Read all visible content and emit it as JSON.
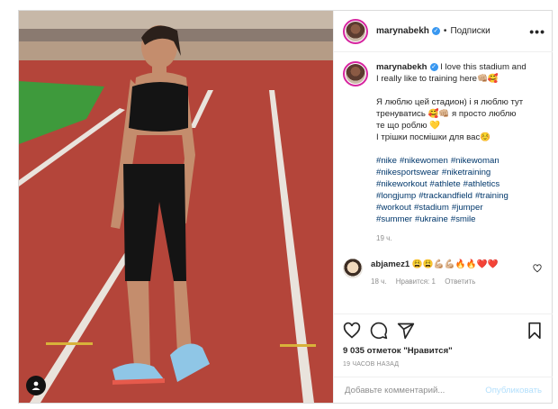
{
  "post": {
    "username": "marynabekh",
    "verified": true,
    "follow_separator": "•",
    "follow_label": "Подписки",
    "more_label": "•••",
    "caption_lines": [
      "I love this stadium and",
      "I really like to training here👊🏼🥰"
    ],
    "caption_ua": [
      "Я люблю цей стадион) і я люблю тут",
      "тренуватись 🥰👊🏼 я просто люблю",
      "те що роблю 💛",
      "І трішки посмішки для вас☺️"
    ],
    "hashtags": [
      "#nike",
      "#nikewomen",
      "#nikewoman",
      "#nikesportswear",
      "#niketraining",
      "#nikeworkout",
      "#athlete",
      "#athletics",
      "#longjump",
      "#trackandfield",
      "#training",
      "#workout",
      "#stadium",
      "#jumper",
      "#summer",
      "#ukraine",
      "#smile"
    ],
    "caption_time": "19 ч.",
    "comment": {
      "username": "abjamez1",
      "text": "😩😩💪🏼💪🏼🔥🔥❤️❤️",
      "time": "18 ч.",
      "likes": "Нравится: 1",
      "reply": "Ответить"
    },
    "likes_text": "9 035 отметок \"Нравится\"",
    "posted_ago": "19 ЧАСОВ НАЗАД",
    "add_comment_placeholder": "Добавьте комментарий...",
    "publish_label": "Опубликовать"
  },
  "colors": {
    "track": "#b4453a",
    "grass": "#3e9a3c",
    "link": "#00376b",
    "verified": "#3897f0",
    "publish_disabled": "#b2dffc"
  }
}
